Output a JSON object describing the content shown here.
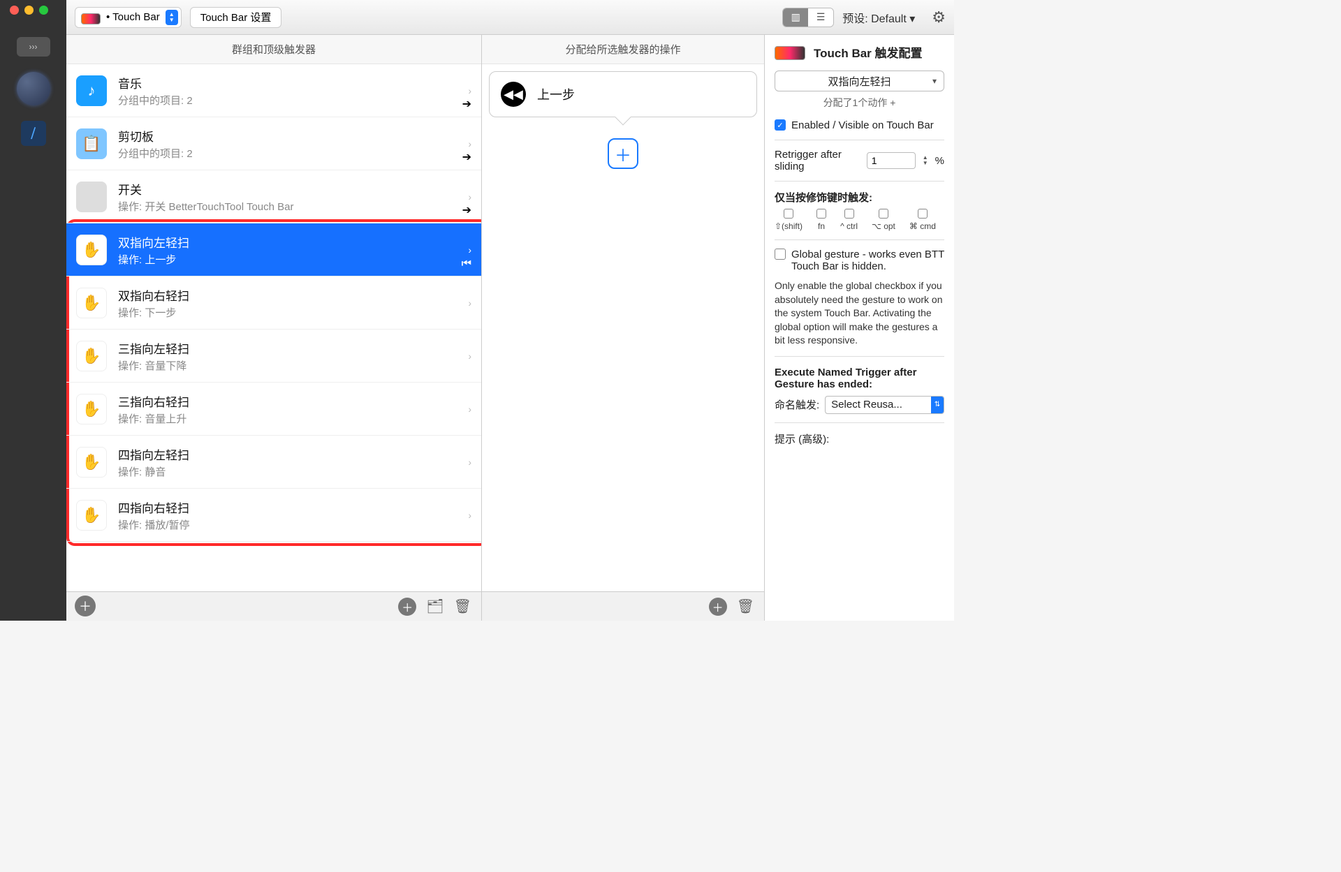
{
  "toolbar": {
    "context_label": "• Touch Bar",
    "settings_btn": "Touch Bar 设置",
    "preset_label": "预设: Default ▾"
  },
  "columns": {
    "triggers_header": "群组和顶级触发器",
    "actions_header": "分配给所选触发器的操作"
  },
  "triggers": [
    {
      "title": "音乐",
      "sub": "分组中的项目: 2",
      "icon": "folder-music"
    },
    {
      "title": "剪切板",
      "sub": "分组中的项目: 2",
      "icon": "folder-clip"
    },
    {
      "title": "开关",
      "sub": "操作: 开关 BetterTouchTool Touch Bar",
      "icon": "avatar"
    },
    {
      "title": "双指向左轻扫",
      "sub": "操作: 上一步",
      "icon": "hand",
      "selected": true
    },
    {
      "title": "双指向右轻扫",
      "sub": "操作: 下一步",
      "icon": "hand"
    },
    {
      "title": "三指向左轻扫",
      "sub": "操作: 音量下降",
      "icon": "hand"
    },
    {
      "title": "三指向右轻扫",
      "sub": "操作: 音量上升",
      "icon": "hand"
    },
    {
      "title": "四指向左轻扫",
      "sub": "操作: 静音",
      "icon": "hand"
    },
    {
      "title": "四指向右轻扫",
      "sub": "操作: 播放/暂停",
      "icon": "hand"
    }
  ],
  "action": {
    "title": "上一步"
  },
  "inspector": {
    "title": "Touch Bar 触发配置",
    "gesture_select": "双指向左轻扫",
    "assigned": "分配了1个动作 +",
    "enabled_label": "Enabled / Visible on Touch Bar",
    "retrigger_label": "Retrigger after sliding",
    "retrigger_value": "1",
    "percent": "%",
    "mod_heading": "仅当按修饰键时触发:",
    "mods": [
      "⇧(shift)",
      "fn",
      "^ ctrl",
      "⌥ opt",
      "⌘ cmd"
    ],
    "global_label": "Global gesture - works even BTT Touch Bar is hidden.",
    "global_help": "Only enable the global checkbox if you absolutely need the gesture to work on the system Touch Bar. Activating the global option will make the gestures a bit less responsive.",
    "exec_label": "Execute Named Trigger after Gesture has ended:",
    "named_label": "命名触发:",
    "named_value": "Select Reusa...",
    "hint_label": "提示 (高级):"
  }
}
